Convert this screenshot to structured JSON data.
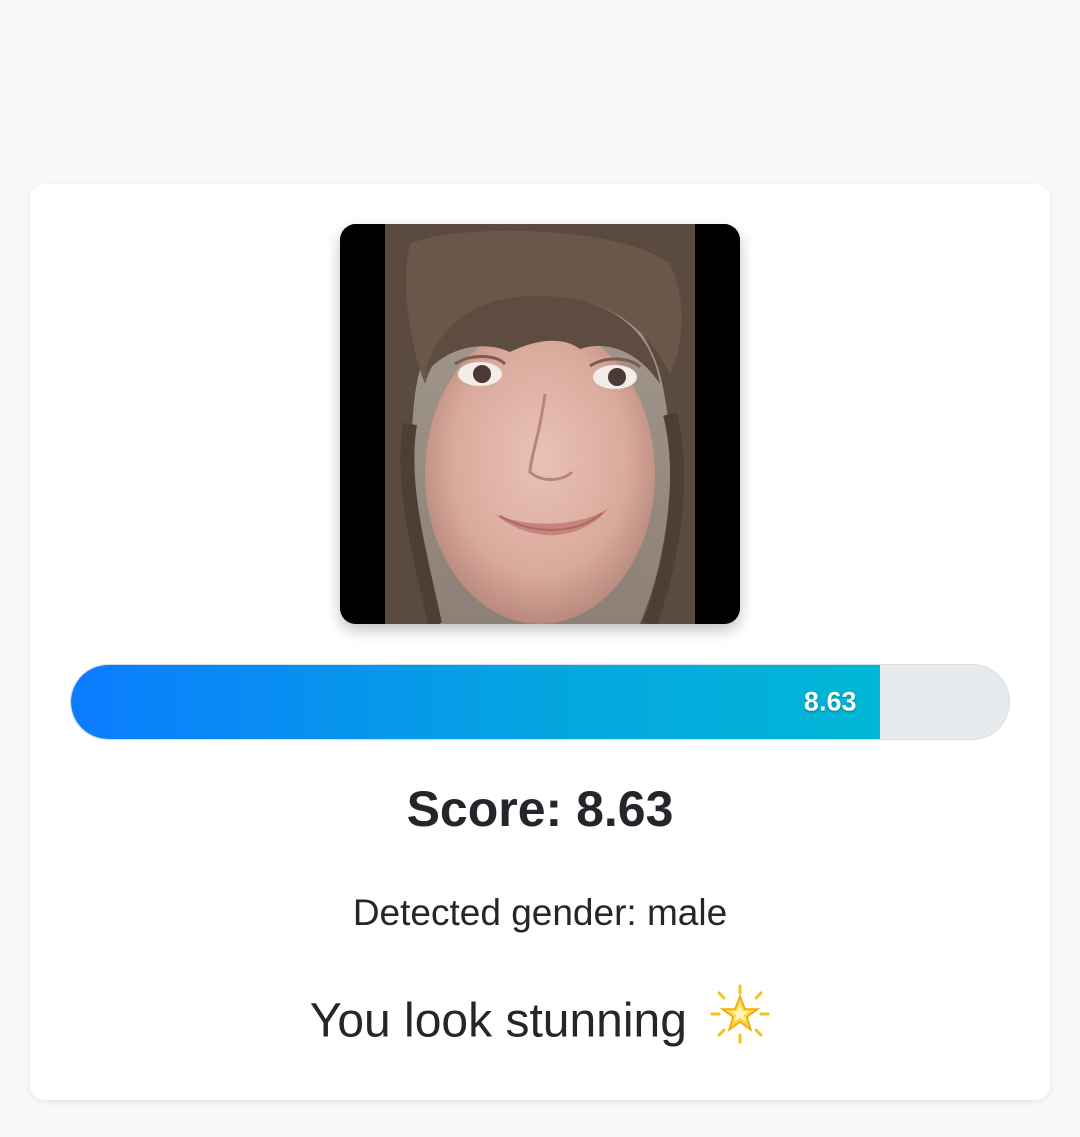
{
  "result": {
    "score_value": 8.63,
    "score_max": 10,
    "bar_label": "8.63",
    "score_heading": "Score: 8.63",
    "gender_text": "Detected gender: male",
    "message_text": "You look stunning",
    "message_icon": "glowing-star-icon"
  },
  "colors": {
    "page_background": "#f7f8fa",
    "card_background": "#ffffff",
    "bar_track": "#e8ebee",
    "bar_fill_start": "#0a7cff",
    "bar_fill_end": "#00b7d5",
    "text": "#25262b"
  }
}
